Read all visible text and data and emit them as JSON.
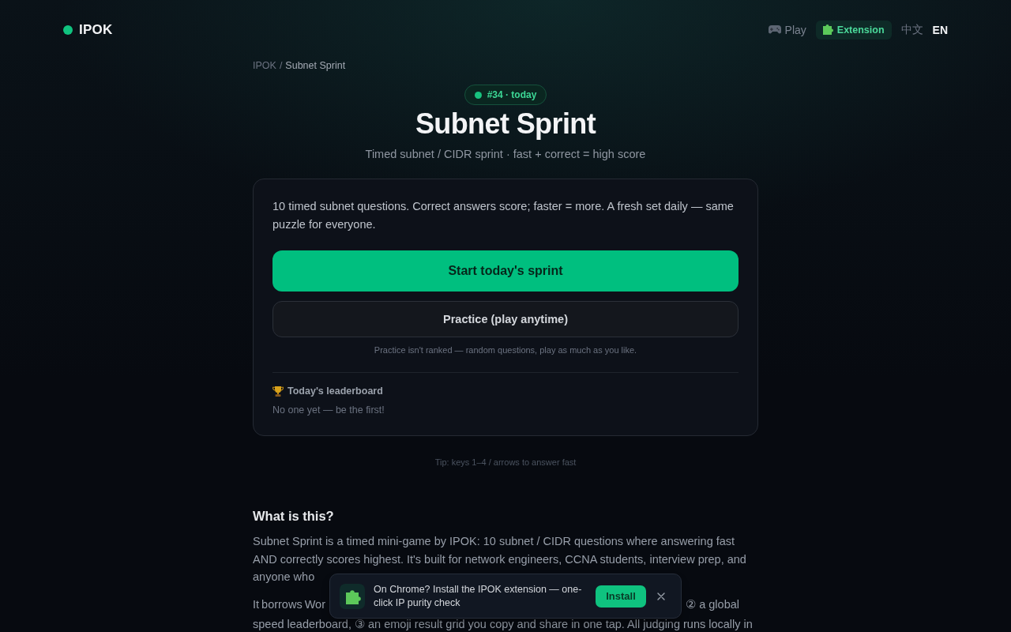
{
  "nav": {
    "brand": "IPOK",
    "items": [
      {
        "kind": "link",
        "label": "Play"
      },
      {
        "kind": "highlight",
        "label": "Extension"
      }
    ],
    "languages": [
      {
        "label": "中文",
        "selected": false
      },
      {
        "label": "EN",
        "selected": true
      }
    ]
  },
  "breadcrumb": {
    "items": [
      "IPOK",
      "Subnet Sprint"
    ],
    "separator": "/"
  },
  "badge": {
    "label": "#34 · today"
  },
  "title": "Subnet Sprint",
  "subtitle": "Timed subnet / CIDR sprint · fast + correct = high score",
  "card": {
    "description": "10 timed subnet questions. Correct answers score; faster = more. A fresh set daily — same puzzle for everyone.",
    "buttons": [
      {
        "kind": "primary",
        "label": "Start today's sprint"
      },
      {
        "kind": "secondary",
        "label": "Practice (play anytime)"
      }
    ],
    "note": "Practice isn't ranked — random questions, play as much as you like.",
    "leaderboard": {
      "title": "Today's leaderboard",
      "empty_text": "No one yet — be the first!"
    }
  },
  "tip": "Tip: keys 1–4 / arrows to answer fast",
  "about": {
    "heading": "What is this?",
    "paragraph_1": "Subnet Sprint is a timed mini-game by IPOK: 10 subnet / CIDR questions where answering fast AND correctly scores highest. It's built for network engineers, CCNA students, interview prep, and anyone who",
    "paragraph_2": {
      "line_1_start": "It borrows Wor",
      "line_1_end": "② a global",
      "line_2": "speed leaderboard, ③ an emoji result grid you copy and share in one tap. All judging runs locally in"
    }
  },
  "toast": {
    "message": "On Chrome? Install the IPOK extension — one-click IP purity check",
    "button": "Install"
  }
}
